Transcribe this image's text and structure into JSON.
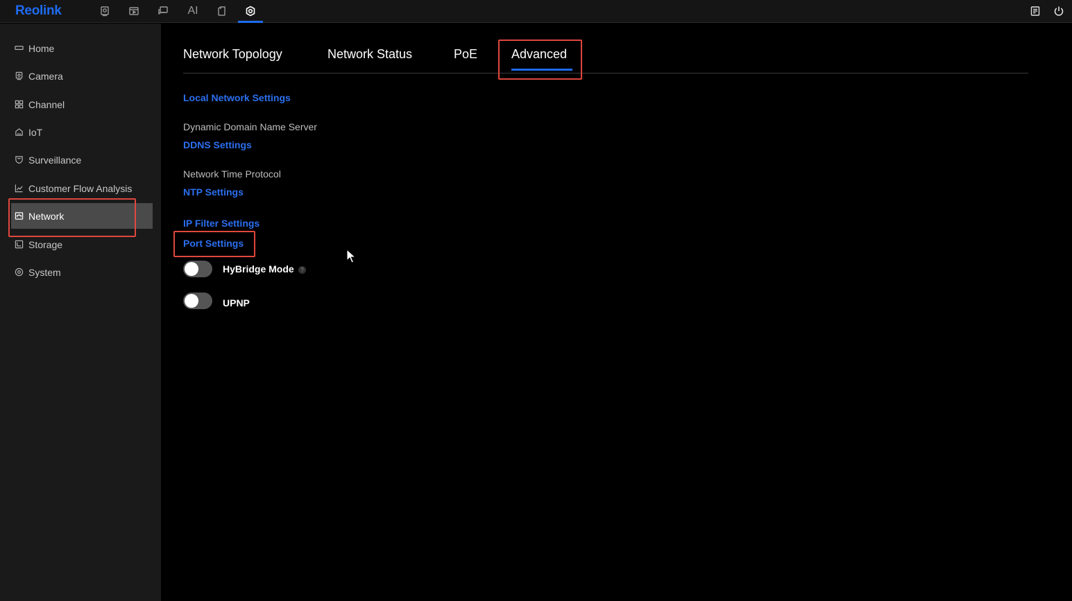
{
  "app": {
    "logo": "Reolink"
  },
  "topbar": {
    "icons": [
      "camera-icon",
      "playback-icon",
      "message-icon",
      "ai-icon",
      "files-icon",
      "settings-icon"
    ],
    "ai_label": "AI",
    "right_icons": [
      "notes-icon",
      "power-icon"
    ]
  },
  "sidebar": {
    "items": [
      {
        "label": "Home",
        "icon": "home-icon"
      },
      {
        "label": "Camera",
        "icon": "camera-icon"
      },
      {
        "label": "Channel",
        "icon": "channel-grid-icon"
      },
      {
        "label": "IoT",
        "icon": "iot-house-icon"
      },
      {
        "label": "Surveillance",
        "icon": "shield-icon"
      },
      {
        "label": "Customer Flow Analysis",
        "icon": "chart-icon"
      },
      {
        "label": "Network",
        "icon": "network-icon"
      },
      {
        "label": "Storage",
        "icon": "storage-icon"
      },
      {
        "label": "System",
        "icon": "system-gear-icon"
      }
    ],
    "active": "Network"
  },
  "tabs": {
    "items": [
      "Network Topology",
      "Network Status",
      "PoE",
      "Advanced"
    ],
    "active": "Advanced"
  },
  "advanced": {
    "local_network_link": "Local Network Settings",
    "ddns_label": "Dynamic Domain Name Server",
    "ddns_link": "DDNS Settings",
    "ntp_label": "Network Time Protocol",
    "ntp_link": "NTP Settings",
    "ip_filter_link": "IP Filter Settings",
    "port_link": "Port Settings",
    "hybridge_label": "HyBridge Mode",
    "hybridge_help": "?",
    "hybridge_on": false,
    "upnp_label": "UPNP",
    "upnp_on": false
  },
  "colors": {
    "accent": "#1e6bf0",
    "highlight": "#e0473d",
    "sidebar_bg": "#1a1a1a",
    "sidebar_active": "#4a4a4a"
  }
}
